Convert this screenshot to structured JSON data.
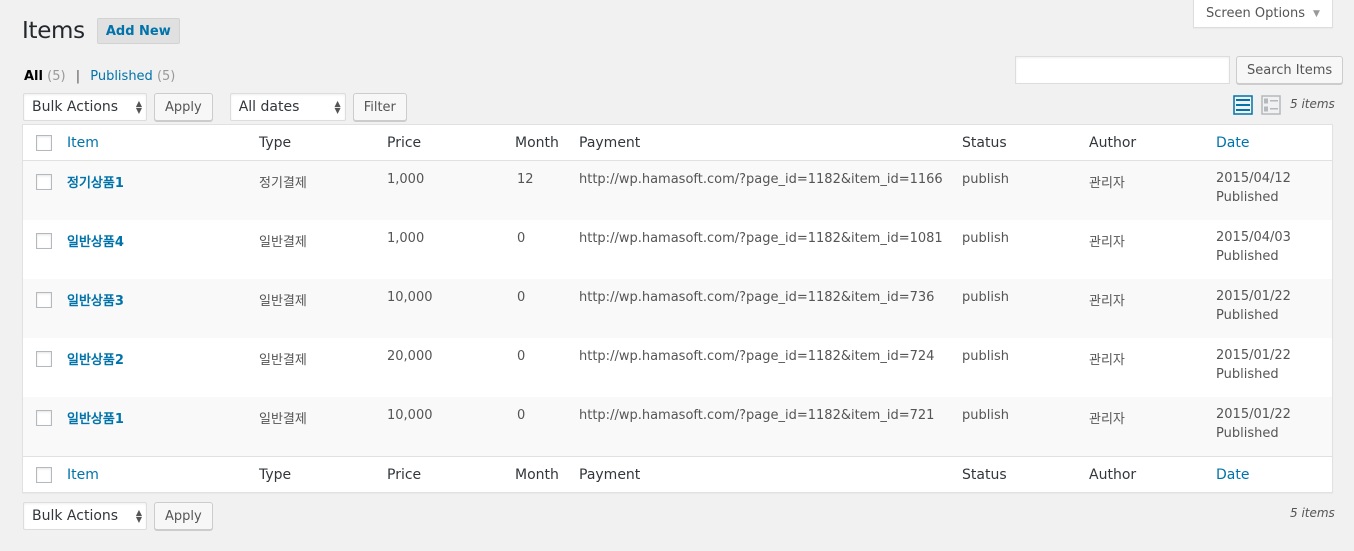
{
  "screen_options": {
    "label": "Screen Options"
  },
  "page": {
    "title": "Items",
    "add_new": "Add New"
  },
  "views": {
    "all_label": "All",
    "all_count": "(5)",
    "separator": "|",
    "published_label": "Published",
    "published_count": "(5)"
  },
  "search": {
    "value": "",
    "button": "Search Items"
  },
  "tablenav_top": {
    "bulk_actions": "Bulk Actions",
    "apply": "Apply",
    "dates": "All dates",
    "filter": "Filter",
    "items_count": "5 items"
  },
  "tablenav_bottom": {
    "bulk_actions": "Bulk Actions",
    "apply": "Apply",
    "items_count": "5 items"
  },
  "columns": {
    "item": "Item",
    "type": "Type",
    "price": "Price",
    "month": "Month",
    "payment": "Payment",
    "status": "Status",
    "author": "Author",
    "date": "Date"
  },
  "rows": [
    {
      "item": "정기상품1",
      "type": "정기결제",
      "price": "1,000",
      "month": "12",
      "payment": "http://wp.hamasoft.com/?page_id=1182&item_id=1166",
      "status": "publish",
      "author": "관리자",
      "date": "2015/04/12",
      "date_status": "Published"
    },
    {
      "item": "일반상품4",
      "type": "일반결제",
      "price": "1,000",
      "month": "0",
      "payment": "http://wp.hamasoft.com/?page_id=1182&item_id=1081",
      "status": "publish",
      "author": "관리자",
      "date": "2015/04/03",
      "date_status": "Published"
    },
    {
      "item": "일반상품3",
      "type": "일반결제",
      "price": "10,000",
      "month": "0",
      "payment": "http://wp.hamasoft.com/?page_id=1182&item_id=736",
      "status": "publish",
      "author": "관리자",
      "date": "2015/01/22",
      "date_status": "Published"
    },
    {
      "item": "일반상품2",
      "type": "일반결제",
      "price": "20,000",
      "month": "0",
      "payment": "http://wp.hamasoft.com/?page_id=1182&item_id=724",
      "status": "publish",
      "author": "관리자",
      "date": "2015/01/22",
      "date_status": "Published"
    },
    {
      "item": "일반상품1",
      "type": "일반결제",
      "price": "10,000",
      "month": "0",
      "payment": "http://wp.hamasoft.com/?page_id=1182&item_id=721",
      "status": "publish",
      "author": "관리자",
      "date": "2015/01/22",
      "date_status": "Published"
    }
  ],
  "colors": {
    "link": "#0073aa",
    "background": "#f1f1f1",
    "row_alt": "#f9f9f9"
  },
  "icons": {
    "list_view": "list-view-icon",
    "excerpt_view": "excerpt-view-icon",
    "dropdown": "chevron-down-icon"
  }
}
